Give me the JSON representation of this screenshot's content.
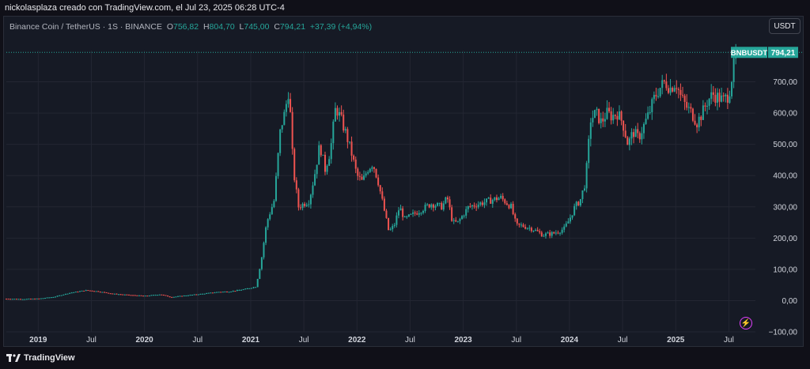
{
  "header": {
    "credit": "nickolasplaza creado con TradingView.com, el Jul 23, 2025 06:28 UTC-4"
  },
  "legend": {
    "symbol": "Binance Coin / TetherUS · 1S · BINANCE",
    "open_label": "O",
    "open": "756,82",
    "high_label": "H",
    "high": "804,70",
    "low_label": "L",
    "low": "745,00",
    "close_label": "C",
    "close": "794,21",
    "change": "+37,39 (+4,94%)"
  },
  "toolbar": {
    "unit_label": "USDT"
  },
  "price_tag": {
    "symbol": "BNBUSDT",
    "value": "794,21"
  },
  "footer": {
    "logo_text": "TradingView"
  },
  "icons": {
    "flash": "lightning-icon",
    "logo": "tradingview-logo-icon"
  },
  "colors": {
    "up": "#26a69a",
    "down": "#ef5350",
    "background": "#161a25",
    "grid": "#232632"
  },
  "chart_data": {
    "type": "candlestick",
    "title": "",
    "xlabel": "",
    "ylabel": "",
    "ylim": [
      -100,
      800
    ],
    "y_ticks": [
      "−100,00",
      "0,00",
      "100,00",
      "200,00",
      "300,00",
      "400,00",
      "500,00",
      "600,00",
      "700,00"
    ],
    "y_tick_values": [
      -100,
      0,
      100,
      200,
      300,
      400,
      500,
      600,
      700
    ],
    "x_ticks": [
      {
        "label": "2019",
        "year": true,
        "t": 2019.0
      },
      {
        "label": "Jul",
        "year": false,
        "t": 2019.5
      },
      {
        "label": "2020",
        "year": true,
        "t": 2020.0
      },
      {
        "label": "Jul",
        "year": false,
        "t": 2020.5
      },
      {
        "label": "2021",
        "year": true,
        "t": 2021.0
      },
      {
        "label": "Jul",
        "year": false,
        "t": 2021.5
      },
      {
        "label": "2022",
        "year": true,
        "t": 2022.0
      },
      {
        "label": "Jul",
        "year": false,
        "t": 2022.5
      },
      {
        "label": "2023",
        "year": true,
        "t": 2023.0
      },
      {
        "label": "Jul",
        "year": false,
        "t": 2023.5
      },
      {
        "label": "2024",
        "year": true,
        "t": 2024.0
      },
      {
        "label": "Jul",
        "year": false,
        "t": 2024.5
      },
      {
        "label": "2025",
        "year": true,
        "t": 2025.0
      },
      {
        "label": "Jul",
        "year": false,
        "t": 2025.5
      }
    ],
    "last_price": 794.21,
    "series": [
      {
        "name": "BNBUSDT",
        "points": [
          [
            2018.7,
            6
          ],
          [
            2018.85,
            5
          ],
          [
            2019.0,
            6
          ],
          [
            2019.15,
            12
          ],
          [
            2019.3,
            25
          ],
          [
            2019.45,
            33
          ],
          [
            2019.55,
            30
          ],
          [
            2019.7,
            22
          ],
          [
            2019.85,
            18
          ],
          [
            2020.0,
            15
          ],
          [
            2020.15,
            20
          ],
          [
            2020.25,
            11
          ],
          [
            2020.4,
            17
          ],
          [
            2020.55,
            22
          ],
          [
            2020.7,
            28
          ],
          [
            2020.8,
            29
          ],
          [
            2020.95,
            37
          ],
          [
            2021.05,
            45
          ],
          [
            2021.1,
            130
          ],
          [
            2021.15,
            250
          ],
          [
            2021.22,
            320
          ],
          [
            2021.28,
            550
          ],
          [
            2021.32,
            600
          ],
          [
            2021.36,
            680
          ],
          [
            2021.4,
            420
          ],
          [
            2021.45,
            300
          ],
          [
            2021.5,
            310
          ],
          [
            2021.55,
            320
          ],
          [
            2021.6,
            400
          ],
          [
            2021.65,
            500
          ],
          [
            2021.7,
            420
          ],
          [
            2021.75,
            480
          ],
          [
            2021.8,
            620
          ],
          [
            2021.85,
            580
          ],
          [
            2021.9,
            530
          ],
          [
            2021.95,
            470
          ],
          [
            2022.0,
            400
          ],
          [
            2022.05,
            380
          ],
          [
            2022.1,
            420
          ],
          [
            2022.15,
            440
          ],
          [
            2022.2,
            380
          ],
          [
            2022.25,
            300
          ],
          [
            2022.3,
            220
          ],
          [
            2022.35,
            240
          ],
          [
            2022.4,
            300
          ],
          [
            2022.45,
            260
          ],
          [
            2022.5,
            270
          ],
          [
            2022.6,
            290
          ],
          [
            2022.7,
            310
          ],
          [
            2022.8,
            300
          ],
          [
            2022.85,
            330
          ],
          [
            2022.9,
            250
          ],
          [
            2022.95,
            250
          ],
          [
            2023.05,
            300
          ],
          [
            2023.15,
            310
          ],
          [
            2023.25,
            320
          ],
          [
            2023.35,
            330
          ],
          [
            2023.45,
            300
          ],
          [
            2023.5,
            240
          ],
          [
            2023.55,
            240
          ],
          [
            2023.65,
            230
          ],
          [
            2023.75,
            210
          ],
          [
            2023.85,
            215
          ],
          [
            2023.95,
            230
          ],
          [
            2024.0,
            260
          ],
          [
            2024.05,
            300
          ],
          [
            2024.1,
            320
          ],
          [
            2024.15,
            380
          ],
          [
            2024.2,
            580
          ],
          [
            2024.25,
            600
          ],
          [
            2024.3,
            570
          ],
          [
            2024.35,
            600
          ],
          [
            2024.4,
            590
          ],
          [
            2024.45,
            600
          ],
          [
            2024.5,
            570
          ],
          [
            2024.55,
            500
          ],
          [
            2024.6,
            540
          ],
          [
            2024.65,
            520
          ],
          [
            2024.7,
            560
          ],
          [
            2024.75,
            600
          ],
          [
            2024.8,
            650
          ],
          [
            2024.85,
            680
          ],
          [
            2024.9,
            700
          ],
          [
            2024.95,
            680
          ],
          [
            2025.0,
            700
          ],
          [
            2025.05,
            650
          ],
          [
            2025.1,
            620
          ],
          [
            2025.15,
            600
          ],
          [
            2025.2,
            570
          ],
          [
            2025.25,
            600
          ],
          [
            2025.3,
            640
          ],
          [
            2025.35,
            660
          ],
          [
            2025.4,
            650
          ],
          [
            2025.45,
            640
          ],
          [
            2025.5,
            660
          ],
          [
            2025.52,
            700
          ],
          [
            2025.55,
            756.82
          ],
          [
            2025.57,
            794.21
          ]
        ]
      }
    ]
  }
}
